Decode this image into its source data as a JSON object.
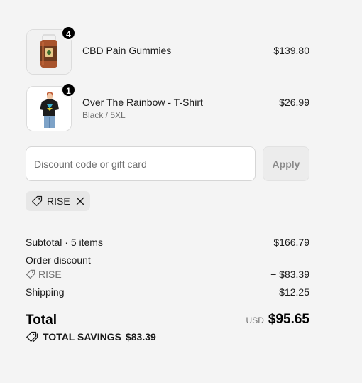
{
  "cart": {
    "items": [
      {
        "name": "CBD Pain Gummies",
        "variant": "",
        "quantity": "4",
        "price": "$139.80",
        "image": "gummies-jar-image"
      },
      {
        "name": "Over The Rainbow - T-Shirt",
        "variant": "Black / 5XL",
        "quantity": "1",
        "price": "$26.99",
        "image": "tshirt-model-image"
      }
    ]
  },
  "discount": {
    "placeholder": "Discount code or gift card",
    "value": "",
    "apply_label": "Apply",
    "applied_code": "RISE"
  },
  "summary": {
    "subtotal_label": "Subtotal · 5 items",
    "subtotal_value": "$166.79",
    "order_discount_label": "Order discount",
    "discount_code": "RISE",
    "discount_value": "− $83.39",
    "shipping_label": "Shipping",
    "shipping_value": "$12.25",
    "total_label": "Total",
    "currency": "USD",
    "total_value": "$95.65",
    "savings_label": "TOTAL SAVINGS",
    "savings_value": "$83.39"
  },
  "colors": {
    "background": "#f4f4f4",
    "text": "#1a1a1a",
    "muted": "#707070",
    "badge": "#000000"
  },
  "icons": [
    "tag-icon",
    "close-icon",
    "price-tags-icon"
  ]
}
